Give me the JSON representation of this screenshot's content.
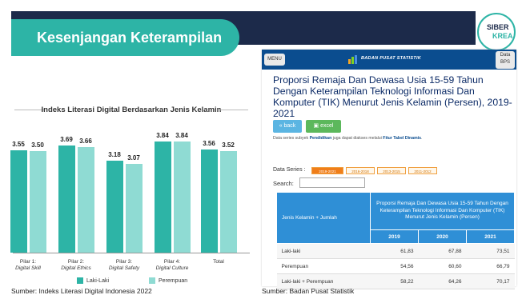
{
  "slide": {
    "title": "Kesenjangan Keterampilan",
    "logo_text_1": "SIBER",
    "logo_text_2": "KREA"
  },
  "left_chart": {
    "source": "Sumber: Indeks Literasi Digital Indonesia 2022"
  },
  "chart_data": {
    "type": "bar",
    "title": "Indeks Literasi Digital Berdasarkan Jenis Kelamin",
    "categories": [
      {
        "line1": "Pilar 1:",
        "line2": "Digital Skill"
      },
      {
        "line1": "Pilar 2:",
        "line2": "Digital Ethics"
      },
      {
        "line1": "Pilar 3:",
        "line2": "Digital Safety"
      },
      {
        "line1": "Pilar 4:",
        "line2": "Digital Culture"
      },
      {
        "line1": "Total",
        "line2": ""
      }
    ],
    "series": [
      {
        "name": "Laki-Laki",
        "color": "#2db4a6",
        "values": [
          3.55,
          3.69,
          3.18,
          3.84,
          3.56
        ]
      },
      {
        "name": "Perempuan",
        "color": "#8fdbd3",
        "values": [
          3.5,
          3.66,
          3.07,
          3.84,
          3.52
        ]
      }
    ],
    "value_labels": [
      "3.55",
      "3.50",
      "3.69",
      "3.66",
      "3.18",
      "3.07",
      "3.84",
      "3.84",
      "3.56",
      "3.52"
    ],
    "ylim": [
      0,
      4
    ],
    "grid": false,
    "legend_position": "bottom"
  },
  "bps": {
    "menu_label": "MENU",
    "brand": "BADAN PUSAT STATISTIK",
    "data_label_1": "Data",
    "data_label_2": "BPS",
    "title": "Proporsi Remaja Dan Dewasa Usia 15-59 Tahun Dengan Keterampilan Teknologi Informasi Dan Komputer (TIK) Menurut Jenis Kelamin (Persen), 2019-2021",
    "back_label": "« back",
    "excel_label": "excel",
    "note_prefix": "Data series subyek ",
    "note_bold1": "Pendidikan",
    "note_middle": " juga dapat diakses melalui ",
    "note_bold2": "Fitur Tabel Dinamis",
    "note_suffix": ".",
    "data_series_label": "Data Series :",
    "series_tabs": [
      "2019-2021",
      "2016-2018",
      "2013-2015",
      "2011-2012"
    ],
    "search_label": "Search:",
    "search_value": "",
    "table": {
      "col_header_left": "Jenis Kelamin + Jumlah",
      "col_header_top": "Proporsi Remaja Dan Dewasa Usia 15-59 Tahun Dengan Keterampilan Teknologi Informasi Dan Komputer (TIK) Menurut Jenis Kelamin (Persen)",
      "years": [
        "2019",
        "2020",
        "2021"
      ],
      "rows": [
        {
          "label": "Laki-laki",
          "values": [
            "61,83",
            "67,88",
            "73,51"
          ]
        },
        {
          "label": "Perempuan",
          "values": [
            "54,56",
            "60,60",
            "66,79"
          ]
        },
        {
          "label": "Laki-laki + Perempuan",
          "values": [
            "58,22",
            "64,26",
            "70,17"
          ]
        }
      ]
    },
    "source": "Sumber: Badan Pusat Statistik"
  }
}
